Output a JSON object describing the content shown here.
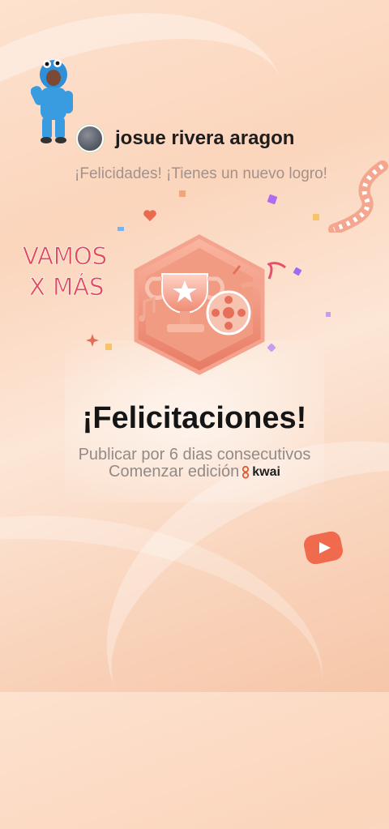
{
  "user": {
    "name": "josue rivera aragon"
  },
  "achievement_notice": "¡Felicidades! ¡Tienes un nuevo logro!",
  "sticker_text": {
    "line1": "VAMOS",
    "line2": "X MÁS"
  },
  "headline": "¡Felicitaciones!",
  "description": "Publicar por 6 dias consecutivos",
  "cta": "Comenzar edición",
  "brand": "kwai",
  "colors": {
    "accent": "#e8735a",
    "badge": "#f08a72",
    "headline": "#151515",
    "muted": "#938a86"
  }
}
